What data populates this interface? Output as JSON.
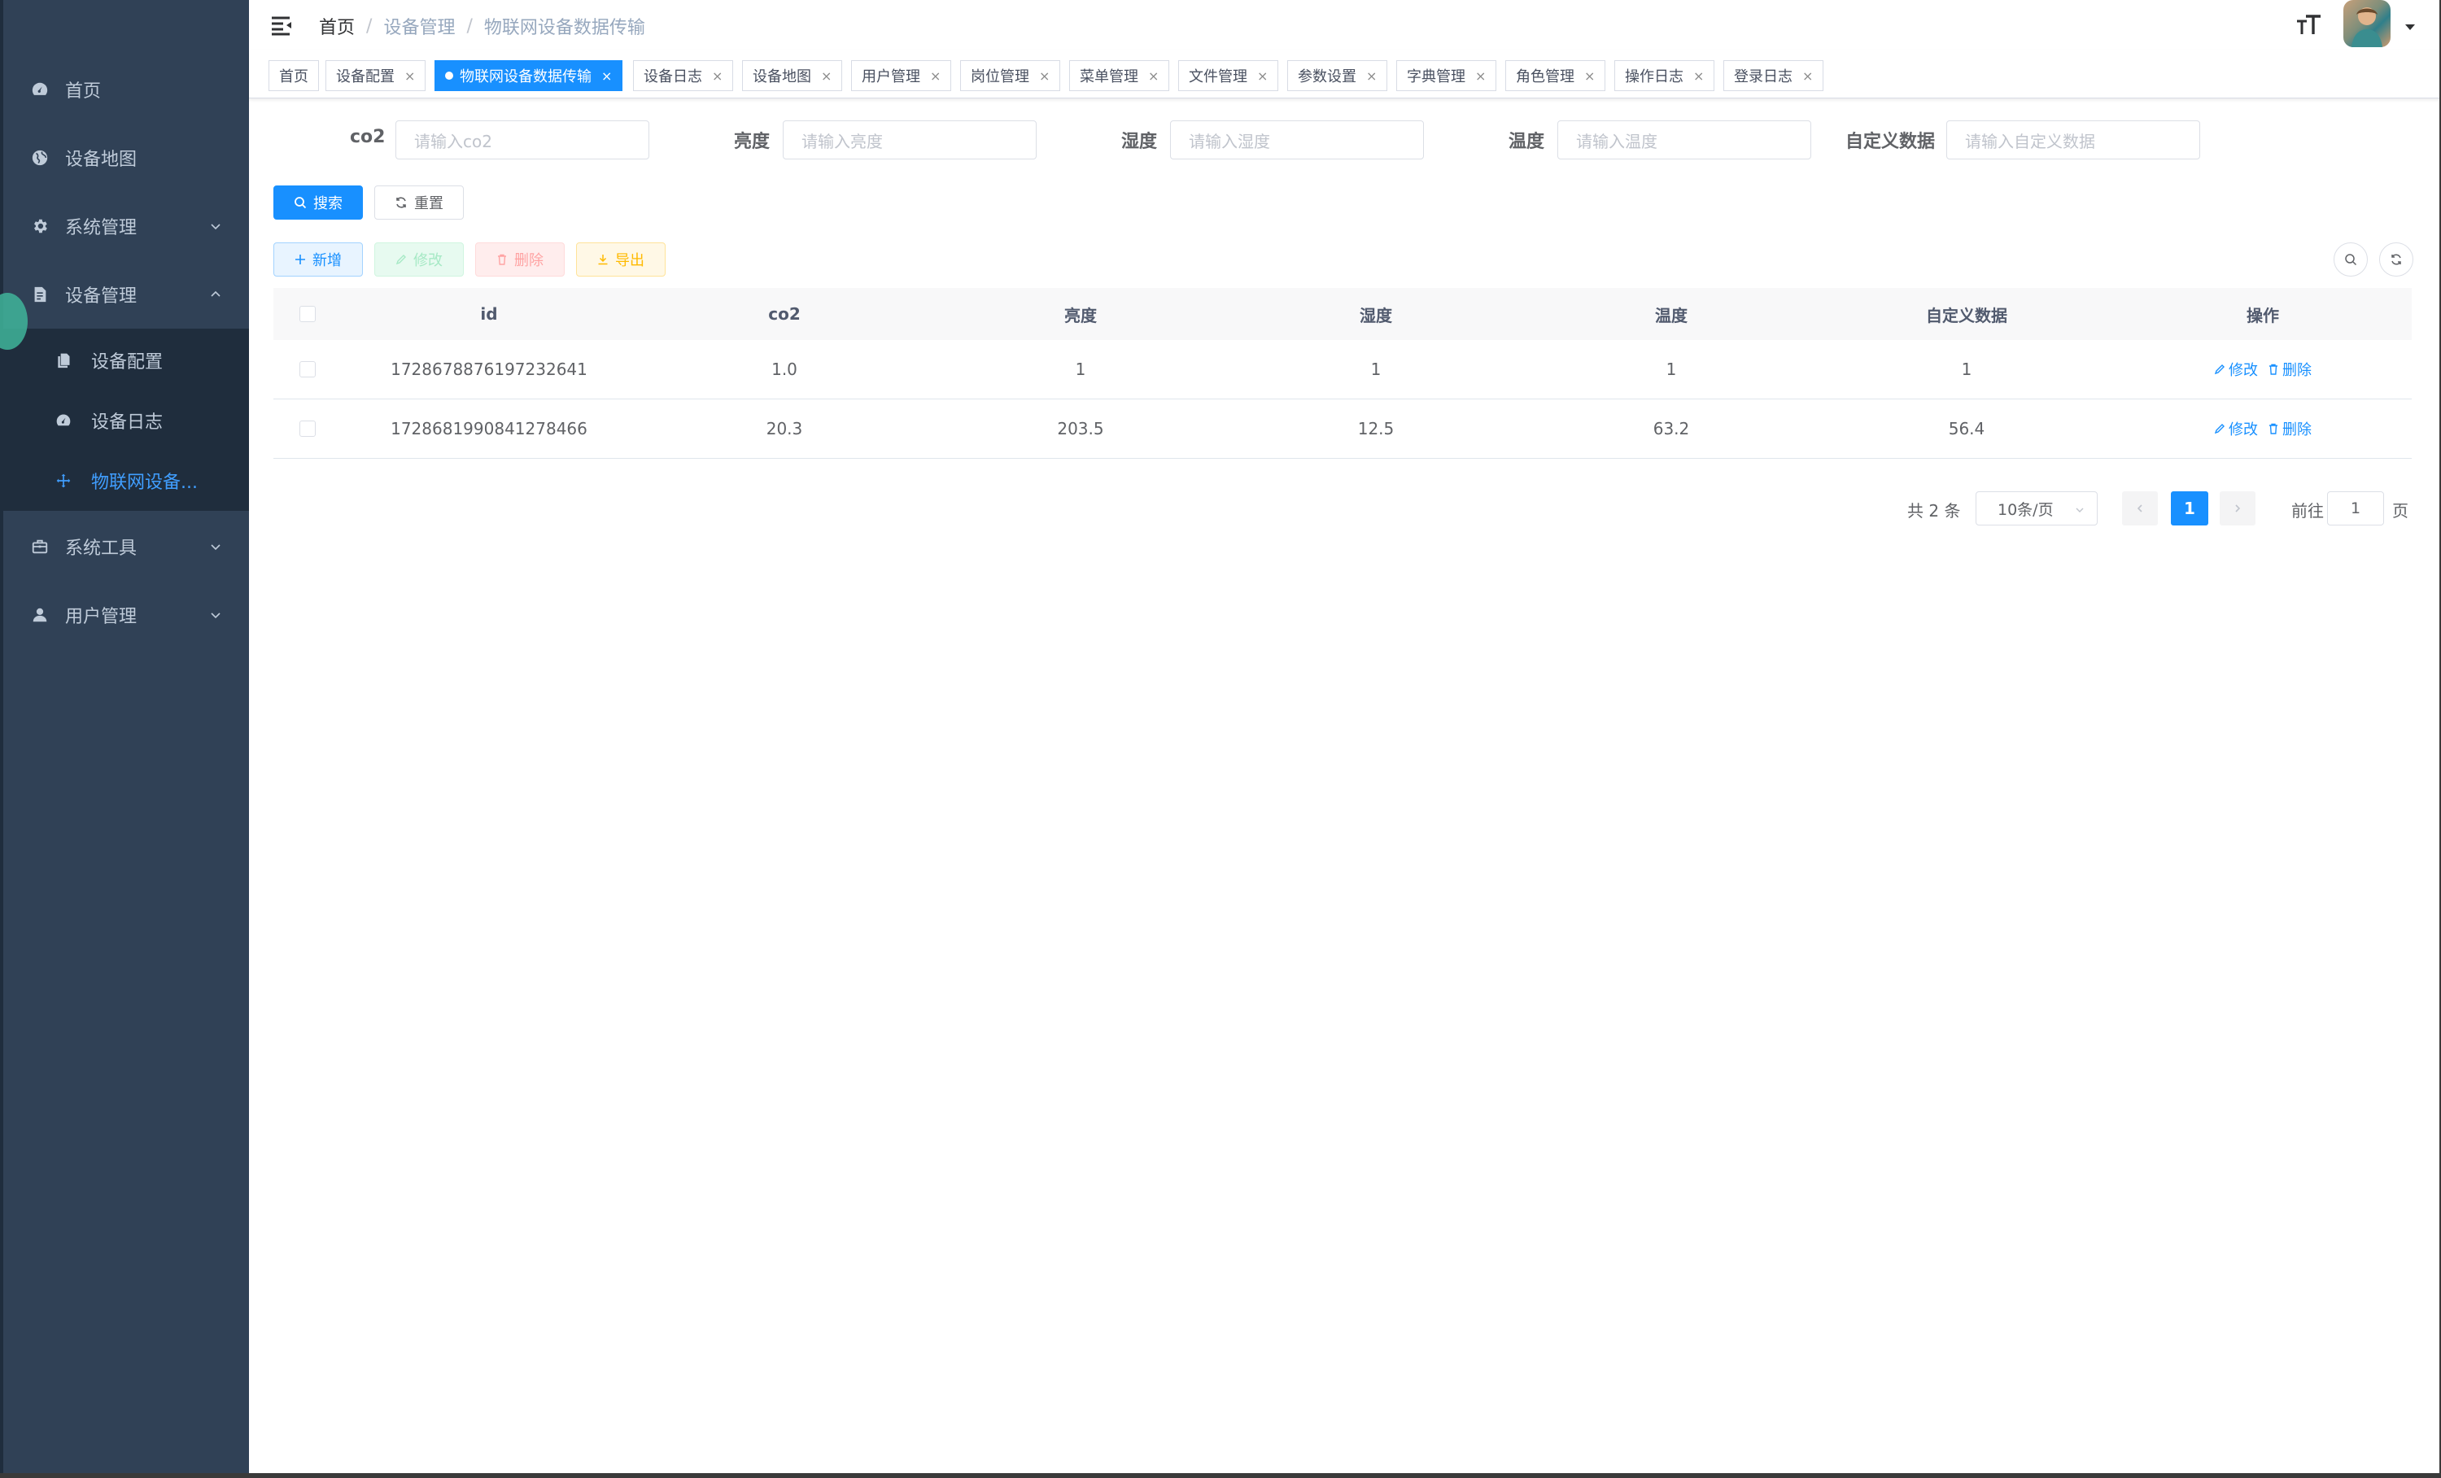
{
  "sidebar": {
    "items": [
      {
        "label": "首页",
        "icon": "dashboard-icon"
      },
      {
        "label": "设备地图",
        "icon": "globe-icon"
      },
      {
        "label": "系统管理",
        "icon": "gear-icon"
      },
      {
        "label": "设备管理",
        "icon": "document-icon",
        "expanded": true
      },
      {
        "label": "系统工具",
        "icon": "toolbox-icon"
      },
      {
        "label": "用户管理",
        "icon": "user-icon"
      }
    ],
    "device_submenu": [
      {
        "label": "设备配置",
        "icon": "copy-icon"
      },
      {
        "label": "设备日志",
        "icon": "dashboard-icon"
      },
      {
        "label": "物联网设备...",
        "icon": "move-icon",
        "active": true
      }
    ]
  },
  "header": {
    "breadcrumb": [
      "首页",
      "设备管理",
      "物联网设备数据传输"
    ],
    "separator": "/"
  },
  "tags": [
    {
      "label": "首页",
      "closable": false
    },
    {
      "label": "设备配置",
      "closable": true
    },
    {
      "label": "物联网设备数据传输",
      "closable": true,
      "active": true
    },
    {
      "label": "设备日志",
      "closable": true
    },
    {
      "label": "设备地图",
      "closable": true
    },
    {
      "label": "用户管理",
      "closable": true
    },
    {
      "label": "岗位管理",
      "closable": true
    },
    {
      "label": "菜单管理",
      "closable": true
    },
    {
      "label": "文件管理",
      "closable": true
    },
    {
      "label": "参数设置",
      "closable": true
    },
    {
      "label": "字典管理",
      "closable": true
    },
    {
      "label": "角色管理",
      "closable": true
    },
    {
      "label": "操作日志",
      "closable": true
    },
    {
      "label": "登录日志",
      "closable": true
    }
  ],
  "tag_close": "×",
  "search_form": {
    "fields": [
      {
        "label": "co2",
        "placeholder": "请输入co2",
        "value": ""
      },
      {
        "label": "亮度",
        "placeholder": "请输入亮度",
        "value": ""
      },
      {
        "label": "湿度",
        "placeholder": "请输入湿度",
        "value": ""
      },
      {
        "label": "温度",
        "placeholder": "请输入温度",
        "value": ""
      },
      {
        "label": "自定义数据",
        "placeholder": "请输入自定义数据",
        "value": ""
      }
    ],
    "search_label": "搜索",
    "reset_label": "重置"
  },
  "toolbar": {
    "add_label": "新增",
    "edit_label": "修改",
    "delete_label": "删除",
    "export_label": "导出"
  },
  "table": {
    "columns": [
      "id",
      "co2",
      "亮度",
      "湿度",
      "温度",
      "自定义数据",
      "操作"
    ],
    "rows": [
      {
        "id": "1728678876197232641",
        "co2": "1.0",
        "brightness": "1",
        "humidity": "1",
        "temperature": "1",
        "custom": "1"
      },
      {
        "id": "1728681990841278466",
        "co2": "20.3",
        "brightness": "203.5",
        "humidity": "12.5",
        "temperature": "63.2",
        "custom": "56.4"
      }
    ],
    "op_edit": "修改",
    "op_delete": "删除"
  },
  "pagination": {
    "total_text": "共 2 条",
    "page_size": "10条/页",
    "current_page": "1",
    "goto_label": "前往",
    "goto_value": "1",
    "page_suffix": "页"
  },
  "colors": {
    "primary": "#1890ff",
    "sidebar_bg": "#304156",
    "submenu_bg": "#1f2d3d",
    "sidebar_active_text": "#409eff",
    "success_light": "#e7faf0",
    "danger_light": "#ffeded",
    "warning_light": "#fff8e6"
  }
}
